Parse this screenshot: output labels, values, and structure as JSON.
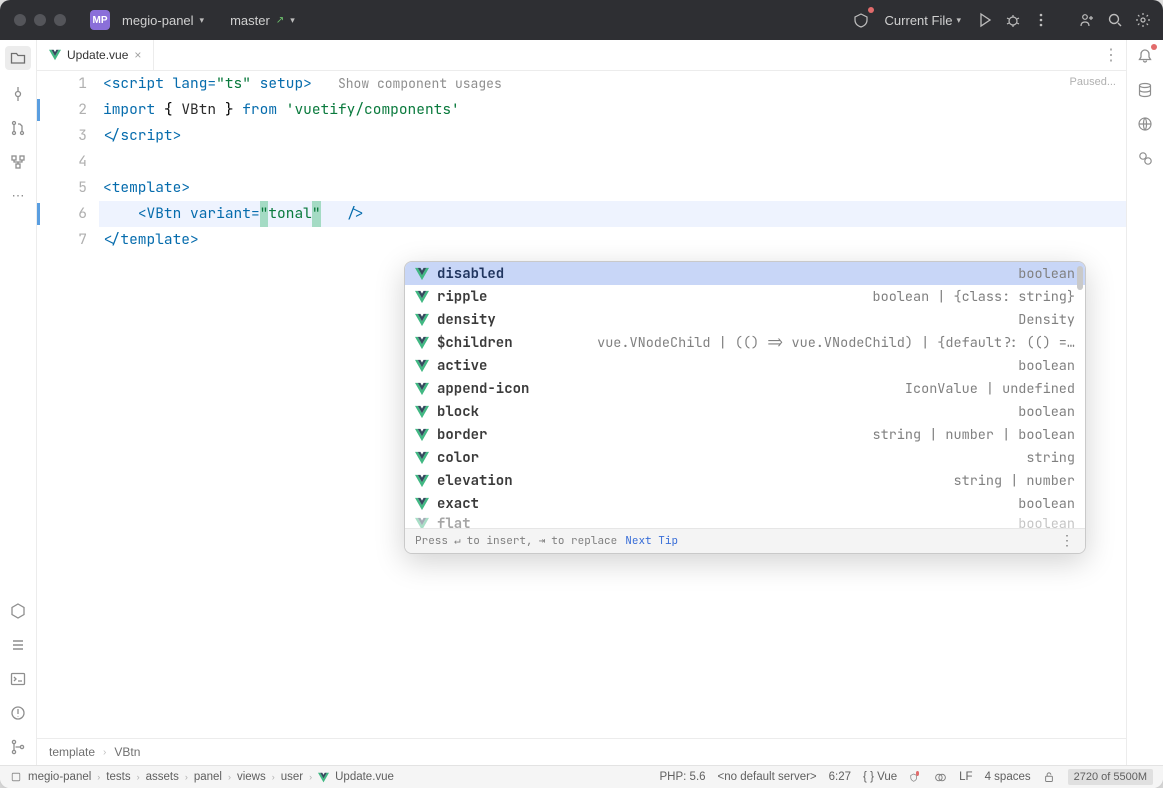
{
  "titlebar": {
    "project_badge": "MP",
    "project_name": "megio-panel",
    "branch_icon": "git-branch-icon",
    "branch_name": "master",
    "run_config": "Current File"
  },
  "tab": {
    "filename": "Update.vue"
  },
  "editor": {
    "status_hint": "Paused...",
    "inline_hint": "Show component usages",
    "gutter": [
      "1",
      "2",
      "3",
      "4",
      "5",
      "6",
      "7"
    ],
    "line1": {
      "open": "<",
      "tag": "script",
      "sp": " ",
      "a1": "lang",
      "eq1": "=",
      "v1": "\"ts\"",
      "sp2": " ",
      "a2": "setup",
      "close": ">"
    },
    "line2": {
      "k1": "import",
      "sp": " ",
      "b1": "{ ",
      "id": "VBtn",
      "b2": " }",
      "sp2": " ",
      "k2": "from",
      "sp3": " ",
      "str": "'vuetify/components'"
    },
    "line3": {
      "open": "</",
      "tag": "script",
      "close": ">"
    },
    "line5": {
      "open": "<",
      "tag": "template",
      "close": ">"
    },
    "line6": {
      "indent": "    ",
      "open": "<",
      "tag": "VBtn",
      "sp": " ",
      "attr": "variant",
      "eq": "=",
      "q1": "\"",
      "val": "tonal",
      "q2": "\"",
      "sp2": "   ",
      "close": "/>"
    },
    "line7": {
      "open": "</",
      "tag": "template",
      "close": ">"
    }
  },
  "popup": {
    "items": [
      {
        "name": "disabled",
        "type": "boolean",
        "selected": true
      },
      {
        "name": "ripple",
        "type": "boolean | {class: string}"
      },
      {
        "name": "density",
        "type": "Density"
      },
      {
        "name": "$children",
        "type": "vue.VNodeChild | (() => vue.VNodeChild) | {default?: (() =…"
      },
      {
        "name": "active",
        "type": "boolean"
      },
      {
        "name": "append-icon",
        "type": "IconValue | undefined"
      },
      {
        "name": "block",
        "type": "boolean"
      },
      {
        "name": "border",
        "type": "string | number | boolean"
      },
      {
        "name": "color",
        "type": "string"
      },
      {
        "name": "elevation",
        "type": "string | number"
      },
      {
        "name": "exact",
        "type": "boolean"
      },
      {
        "name": "flat",
        "type": "boolean",
        "faded": true
      }
    ],
    "footer": {
      "t1": "Press ",
      "k1": "↵",
      "t2": " to insert, ",
      "k2": "⇥",
      "t3": " to replace",
      "link": "Next Tip"
    }
  },
  "breadcrumb": {
    "a": "template",
    "b": "VBtn"
  },
  "statusbar": {
    "project_seg": "megio-panel",
    "path": [
      "tests",
      "assets",
      "panel",
      "views",
      "user"
    ],
    "file": "Update.vue",
    "php": "PHP: 5.6",
    "server": "<no default server>",
    "caret": "6:27",
    "lang": "Vue",
    "encoding": "LF",
    "indent": "4 spaces",
    "memory": "2720 of 5500M"
  }
}
